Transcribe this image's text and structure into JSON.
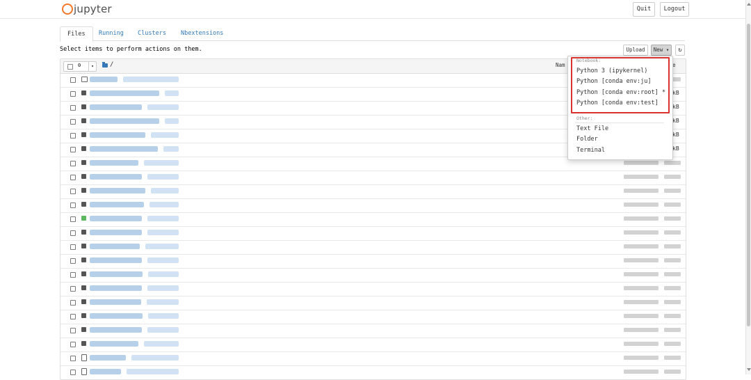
{
  "header": {
    "logo_text": "jupyter",
    "quit_label": "Quit",
    "logout_label": "Logout",
    "brand_color": "#f37726"
  },
  "tabs": [
    {
      "label": "Files",
      "active": true
    },
    {
      "label": "Running",
      "active": false
    },
    {
      "label": "Clusters",
      "active": false
    },
    {
      "label": "Nbextensions",
      "active": false
    }
  ],
  "toolbar": {
    "instructions": "Select items to perform actions on them.",
    "upload_label": "Upload",
    "new_label": "New",
    "refresh_icon": "refresh-icon"
  },
  "file_list": {
    "selected_count": "0",
    "path": "/",
    "sort_name_label": "Nam",
    "sort_last_label": "e",
    "size_suffix": "kB",
    "rows": [
      {
        "type": "folder"
      },
      {
        "type": "notebook",
        "size": "kB"
      },
      {
        "type": "notebook",
        "size": "kB"
      },
      {
        "type": "notebook",
        "size": "kB"
      },
      {
        "type": "notebook",
        "size": "kB"
      },
      {
        "type": "notebook",
        "size": "kB"
      },
      {
        "type": "notebook"
      },
      {
        "type": "notebook"
      },
      {
        "type": "notebook"
      },
      {
        "type": "notebook"
      },
      {
        "type": "notebook-running"
      },
      {
        "type": "notebook"
      },
      {
        "type": "notebook"
      },
      {
        "type": "notebook"
      },
      {
        "type": "notebook"
      },
      {
        "type": "notebook"
      },
      {
        "type": "notebook"
      },
      {
        "type": "notebook"
      },
      {
        "type": "notebook"
      },
      {
        "type": "notebook"
      },
      {
        "type": "file"
      },
      {
        "type": "file"
      }
    ]
  },
  "new_menu": {
    "notebook_header": "Notebook:",
    "notebook_kernels": [
      "Python 3 (ipykernel)",
      "Python [conda env:ju]",
      "Python [conda env:root] *",
      "Python [conda env:test]"
    ],
    "other_header": "Other:",
    "other_items": [
      "Text File",
      "Folder",
      "Terminal"
    ],
    "highlight_color": "#d9322e"
  }
}
